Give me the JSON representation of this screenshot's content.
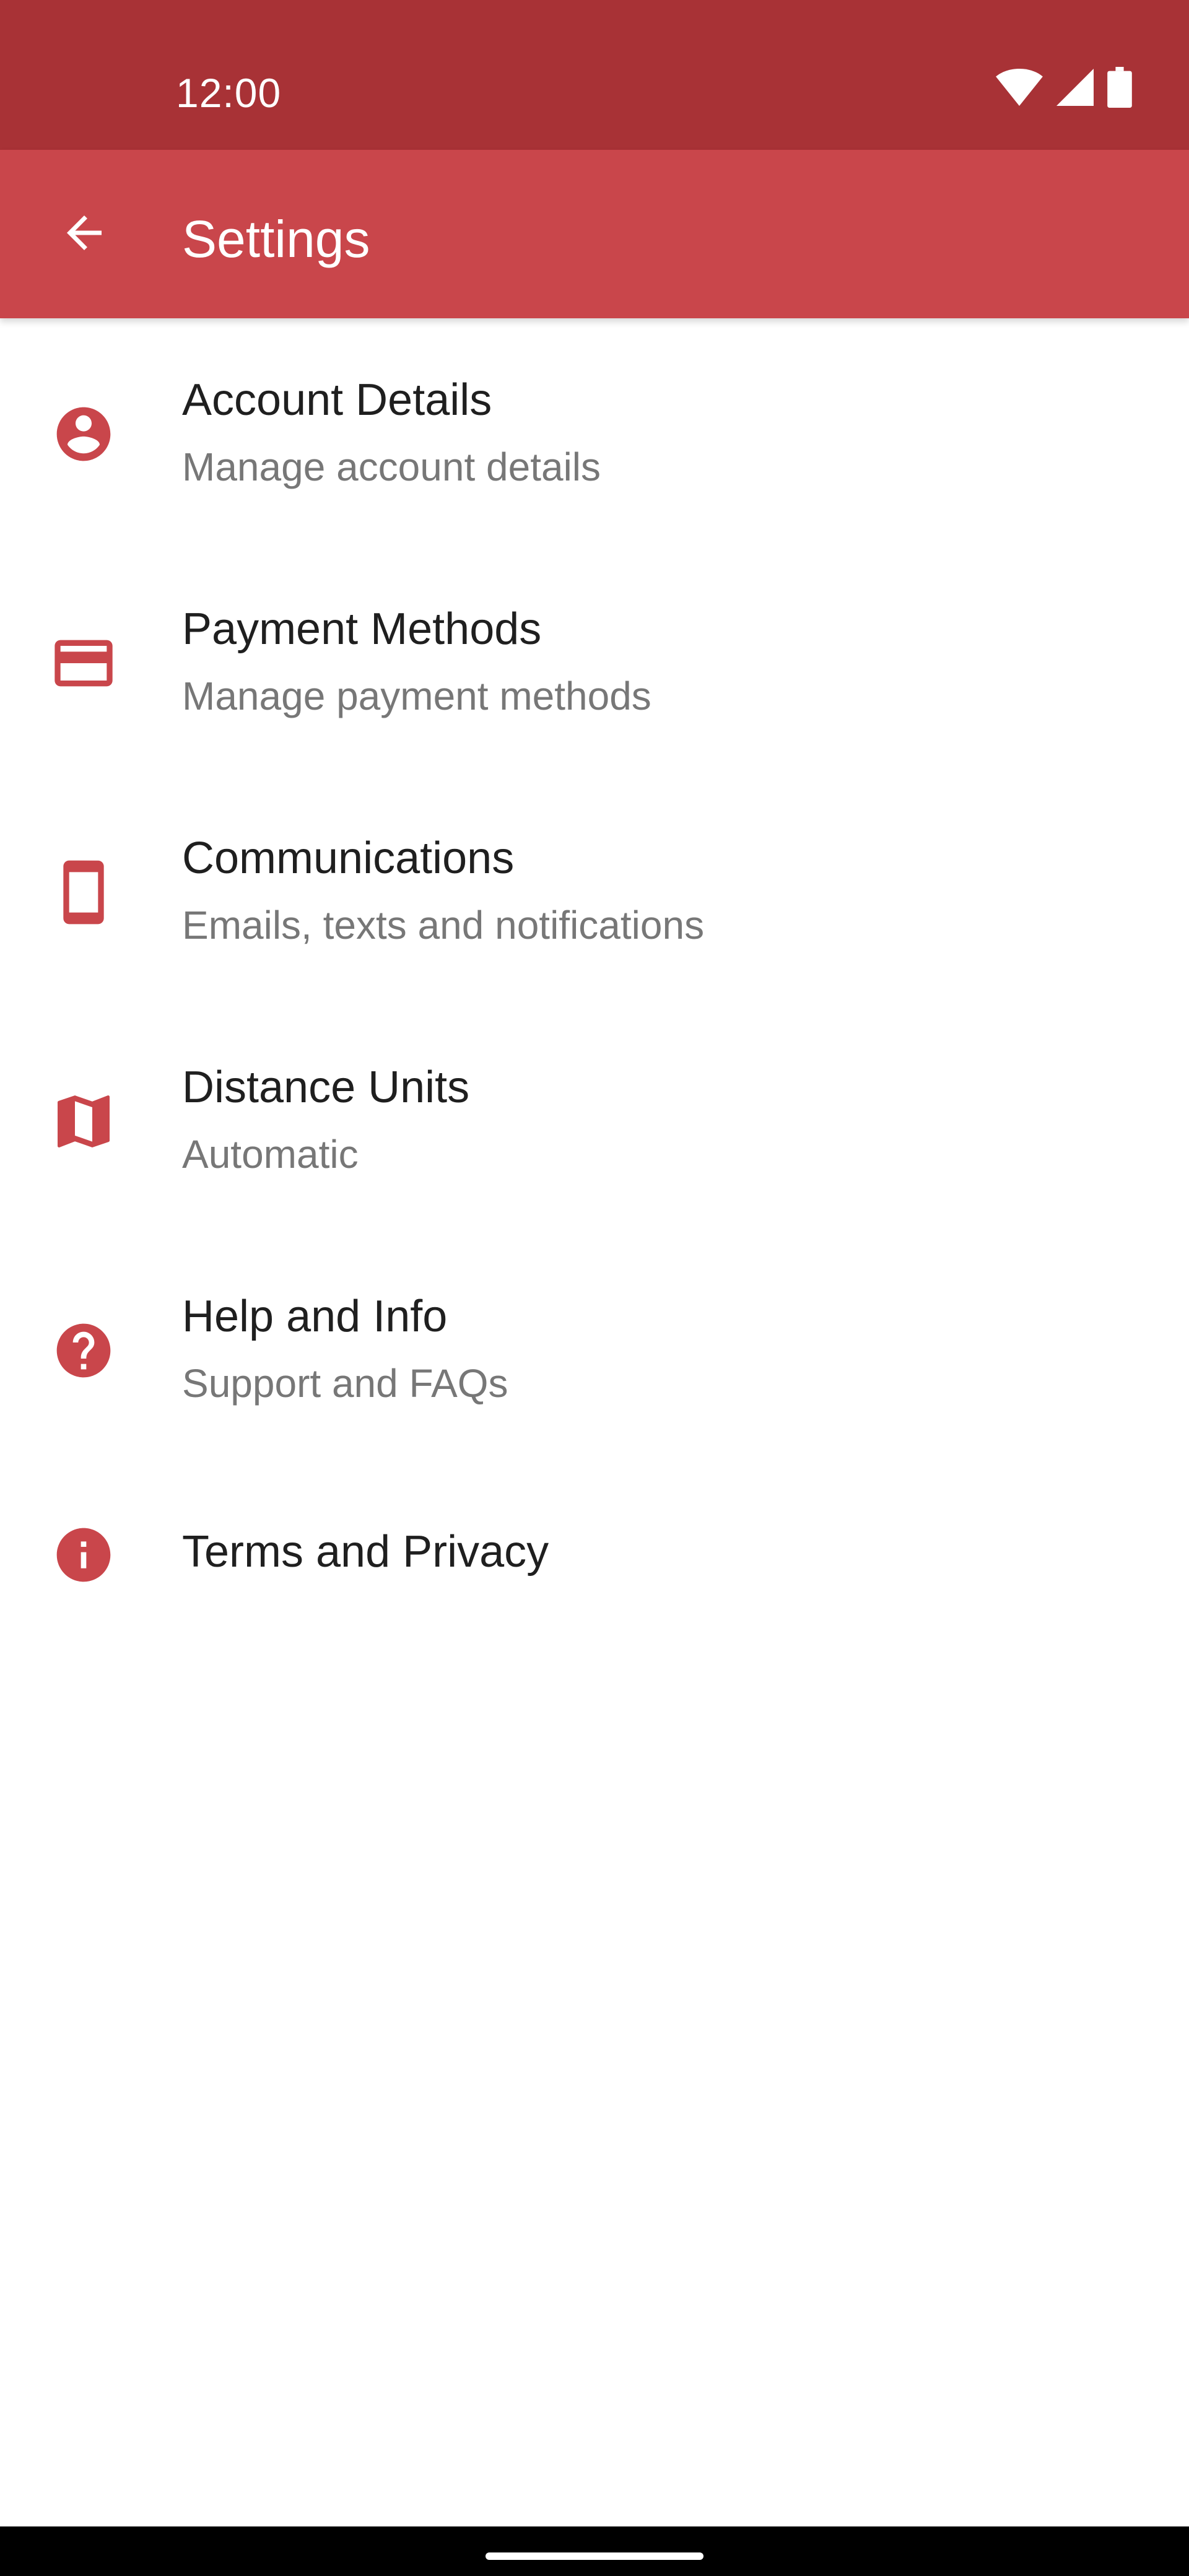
{
  "status_bar": {
    "time": "12:00",
    "background": "#a83236",
    "icons": [
      "wifi-icon",
      "cell-signal-icon",
      "battery-icon"
    ]
  },
  "app_bar": {
    "title": "Settings",
    "background": "#c9464b",
    "back_icon": "arrow-back-icon"
  },
  "accent_color": "#c9464b",
  "items": [
    {
      "title": "Account Details",
      "subtitle": "Manage account details",
      "icon": "account-circle-icon"
    },
    {
      "title": "Payment Methods",
      "subtitle": "Manage payment methods",
      "icon": "credit-card-icon"
    },
    {
      "title": "Communications",
      "subtitle": "Emails, texts and notifications",
      "icon": "smartphone-icon"
    },
    {
      "title": "Distance Units",
      "subtitle": "Automatic",
      "icon": "map-icon"
    },
    {
      "title": "Help and Info",
      "subtitle": "Support and FAQs",
      "icon": "help-icon"
    },
    {
      "title": "Terms and Privacy",
      "icon": "info-icon"
    }
  ]
}
